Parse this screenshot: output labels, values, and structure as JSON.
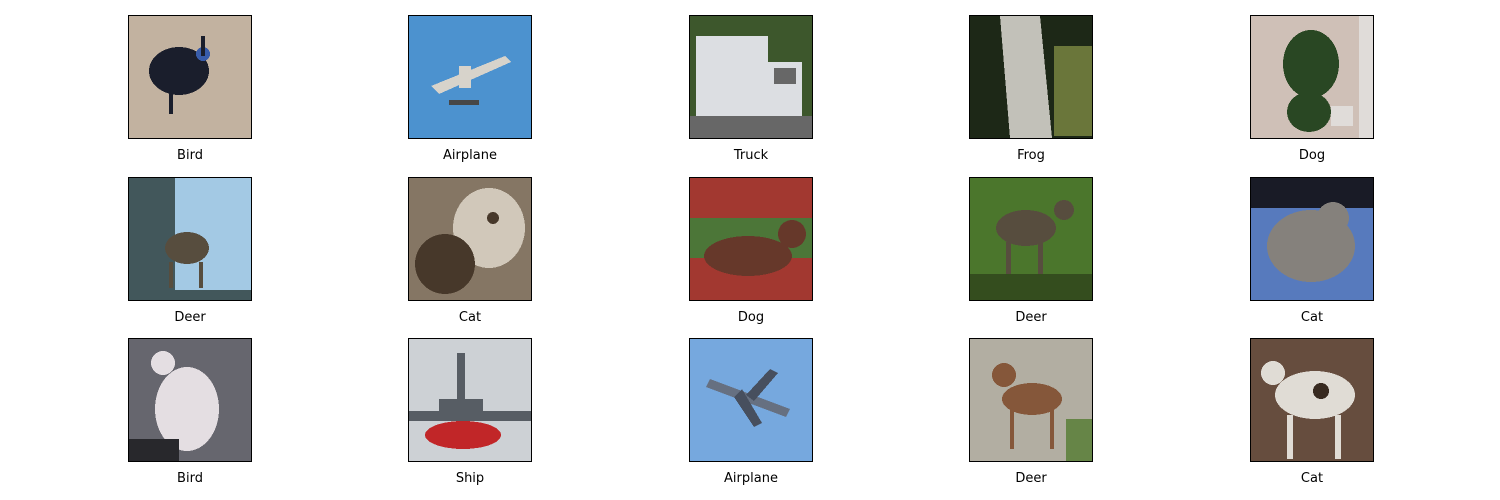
{
  "grid": {
    "images": [
      {
        "label": "Bird",
        "icon": "cassowary-photo",
        "bg": "#c9b8a6",
        "fg": "#1b1f2e",
        "accent": "#3a5fb0"
      },
      {
        "label": "Airplane",
        "icon": "seaplane-photo",
        "bg": "#4f97d6",
        "fg": "#dedad2",
        "accent": "#4a4a4a"
      },
      {
        "label": "Truck",
        "icon": "white-truck-photo",
        "bg": "#3f5a2e",
        "fg": "#e4e6ea",
        "accent": "#6b6b6b"
      },
      {
        "label": "Frog",
        "icon": "frog-photo",
        "bg": "#1e2a18",
        "fg": "#c9c8bf",
        "accent": "#6e7a3c"
      },
      {
        "label": "Dog",
        "icon": "dog-in-grass-photo",
        "bg": "#d6c7bd",
        "fg": "#2b4a25",
        "accent": "#e8e4e0"
      },
      {
        "label": "Deer",
        "icon": "deer-lake-photo",
        "bg": "#a9d0ec",
        "fg": "#5a5040",
        "accent": "#455a5e"
      },
      {
        "label": "Cat",
        "icon": "cat-closeup-photo",
        "bg": "#8a7a68",
        "fg": "#d8cfc0",
        "accent": "#4a3a2c"
      },
      {
        "label": "Dog",
        "icon": "dog-flowers-photo",
        "bg": "#a83a32",
        "fg": "#6a3a2c",
        "accent": "#4f7a3a"
      },
      {
        "label": "Deer",
        "icon": "deer-field-photo",
        "bg": "#4e7a2e",
        "fg": "#5a5040",
        "accent": "#36501f"
      },
      {
        "label": "Cat",
        "icon": "cat-blue-bg-photo",
        "bg": "#5a7ec4",
        "fg": "#8a8680",
        "accent": "#1a1c28"
      },
      {
        "label": "Bird",
        "icon": "white-bird-photo",
        "bg": "#6a6a72",
        "fg": "#ece6ea",
        "accent": "#2a2a2e"
      },
      {
        "label": "Ship",
        "icon": "tugboat-photo",
        "bg": "#d4d8dc",
        "fg": "#c8282a",
        "accent": "#5a6068"
      },
      {
        "label": "Airplane",
        "icon": "jet-sky-photo",
        "bg": "#7aaee6",
        "fg": "#6a7486",
        "accent": "#4a5262"
      },
      {
        "label": "Deer",
        "icon": "fawn-photo",
        "bg": "#b8b4a8",
        "fg": "#8a5a3c",
        "accent": "#6a8a4a"
      },
      {
        "label": "Cat",
        "icon": "spotted-animal-photo",
        "bg": "#6a5040",
        "fg": "#e8e4dc",
        "accent": "#3a2c22"
      }
    ]
  }
}
